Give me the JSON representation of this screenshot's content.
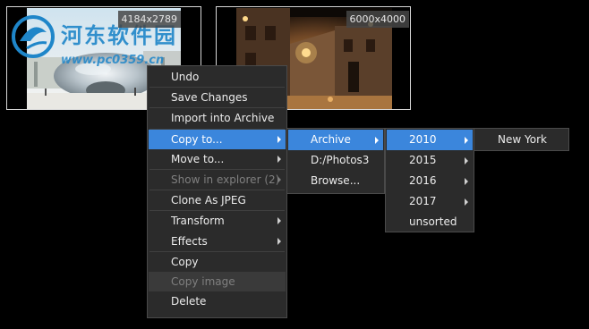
{
  "thumbnails": [
    {
      "dimensions": "4184x2789",
      "watermark_text": "河东软件园",
      "watermark_url": "www.pc0359.cn"
    },
    {
      "dimensions": "6000x4000"
    }
  ],
  "context_menu": {
    "items": [
      {
        "label": "Undo"
      },
      {
        "label": "Save Changes"
      },
      {
        "label": "Import into Archive"
      },
      {
        "label": "Copy to..."
      },
      {
        "label": "Move to..."
      },
      {
        "label": "Show in explorer (2)"
      },
      {
        "label": "Clone As JPEG"
      },
      {
        "label": "Transform"
      },
      {
        "label": "Effects"
      },
      {
        "label": "Copy"
      },
      {
        "label": "Copy image"
      },
      {
        "label": "Delete"
      }
    ]
  },
  "copy_to_menu": {
    "items": [
      {
        "label": "Archive"
      },
      {
        "label": "D:/Photos3"
      },
      {
        "label": "Browse..."
      }
    ]
  },
  "archive_menu": {
    "items": [
      {
        "label": "2010"
      },
      {
        "label": "2015"
      },
      {
        "label": "2016"
      },
      {
        "label": "2017"
      },
      {
        "label": "unsorted"
      }
    ]
  },
  "year_menu": {
    "items": [
      {
        "label": "New York"
      }
    ]
  },
  "colors": {
    "highlight": "#3b86dc",
    "menu_bg": "#2b2b2b",
    "disabled_text": "#7f7f7f",
    "watermark": "#1f86c9"
  }
}
